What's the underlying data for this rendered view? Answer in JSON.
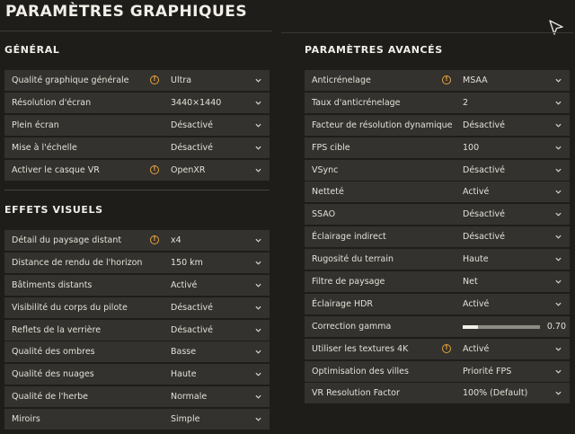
{
  "page_title": "PARAMÈTRES GRAPHIQUES",
  "colors": {
    "background": "#1e1d1a",
    "row": "#33322e",
    "warning": "#e8a33a",
    "text": "#e4e0d8"
  },
  "general": {
    "title": "GÉNÉRAL",
    "rows": [
      {
        "label": "Qualité graphique générale",
        "value": "Ultra",
        "warning": true
      },
      {
        "label": "Résolution d'écran",
        "value": "3440×1440",
        "warning": false
      },
      {
        "label": "Plein écran",
        "value": "Désactivé",
        "warning": false
      },
      {
        "label": "Mise à l'échelle",
        "value": "Désactivé",
        "warning": false
      },
      {
        "label": "Activer le casque VR",
        "value": "OpenXR",
        "warning": true
      }
    ]
  },
  "visual": {
    "title": "EFFETS VISUELS",
    "rows": [
      {
        "label": "Détail du paysage distant",
        "value": "x4",
        "warning": true
      },
      {
        "label": "Distance de rendu de l'horizon",
        "value": "150 km",
        "warning": false
      },
      {
        "label": "Bâtiments distants",
        "value": "Activé",
        "warning": false
      },
      {
        "label": "Visibilité du corps du pilote",
        "value": "Désactivé",
        "warning": false
      },
      {
        "label": "Reflets de la verrière",
        "value": "Désactivé",
        "warning": false
      },
      {
        "label": "Qualité des ombres",
        "value": "Basse",
        "warning": false
      },
      {
        "label": "Qualité des nuages",
        "value": "Haute",
        "warning": false
      },
      {
        "label": "Qualité de l'herbe",
        "value": "Normale",
        "warning": false
      },
      {
        "label": "Miroirs",
        "value": "Simple",
        "warning": false
      }
    ]
  },
  "advanced": {
    "title": "PARAMÈTRES AVANCÉS",
    "rows": [
      {
        "label": "Anticrénelage",
        "value": "MSAA",
        "warning": true
      },
      {
        "label": "Taux d'anticrénelage",
        "value": "2",
        "warning": false
      },
      {
        "label": "Facteur de résolution dynamique",
        "value": "Désactivé",
        "warning": false
      },
      {
        "label": "FPS cible",
        "value": "100",
        "warning": false
      },
      {
        "label": "VSync",
        "value": "Désactivé",
        "warning": false
      },
      {
        "label": "Netteté",
        "value": "Activé",
        "warning": false
      },
      {
        "label": "SSAO",
        "value": "Désactivé",
        "warning": false
      },
      {
        "label": "Éclairage indirect",
        "value": "Désactivé",
        "warning": false
      },
      {
        "label": "Rugosité du terrain",
        "value": "Haute",
        "warning": false
      },
      {
        "label": "Filtre de paysage",
        "value": "Net",
        "warning": false
      },
      {
        "label": "Éclairage HDR",
        "value": "Activé",
        "warning": false
      },
      {
        "label": "Correction gamma",
        "type": "slider",
        "value": "0.70",
        "fill": 0.2
      },
      {
        "label": "Utiliser les textures 4K",
        "value": "Activé",
        "warning": true
      },
      {
        "label": "Optimisation des villes",
        "value": "Priorité FPS",
        "warning": false
      },
      {
        "label": "VR Resolution Factor",
        "value": "100% (Default)",
        "warning": false
      }
    ]
  }
}
